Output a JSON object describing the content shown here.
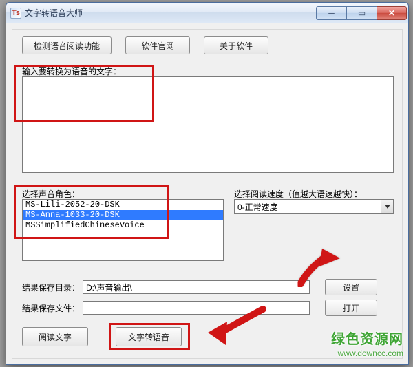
{
  "window": {
    "title": "文字转语音大师",
    "icon_text": "Ts"
  },
  "toolbar": {
    "detect_voice": "检测语音阅读功能",
    "official_site": "软件官网",
    "about": "关于软件"
  },
  "labels": {
    "input_label": "输入要转换为语音的文字：",
    "voice_label": "选择声音角色：",
    "speed_label": "选择阅读速度（值越大语速越快）：",
    "outdir_label": "结果保存目录：",
    "outfile_label": "结果保存文件："
  },
  "input_text": "",
  "voices": {
    "items": [
      "MS-Lili-2052-20-DSK",
      "MS-Anna-1033-20-DSK",
      "MSSimplifiedChineseVoice"
    ],
    "selected_index": 1
  },
  "speed": {
    "selected": "0-正常速度"
  },
  "output": {
    "dir": "D:\\声音输出\\",
    "file": ""
  },
  "buttons": {
    "settings": "设置",
    "open": "打开",
    "read_text": "阅读文字",
    "convert": "文字转语音"
  },
  "watermark": {
    "cn": "绿色资源网",
    "en": "www.downcc.com"
  }
}
